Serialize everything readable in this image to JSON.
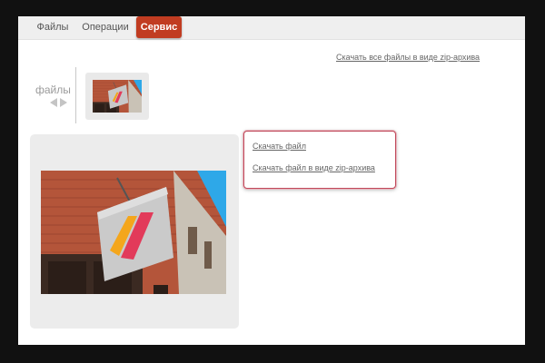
{
  "tabs": [
    {
      "label": "Файлы"
    },
    {
      "label": "Операции"
    },
    {
      "label": "Сервис",
      "active": true
    }
  ],
  "links": {
    "download_all_zip": "Скачать все файлы в виде zip-архива"
  },
  "files_panel": {
    "label": "файлы"
  },
  "download_popup": {
    "download_file": "Скачать файл",
    "download_zip": "Скачать файл в виде zip-архива"
  },
  "icons": [
    "chevron-left-icon",
    "chevron-right-icon"
  ],
  "colors": {
    "active_tab": "#c13c21",
    "tab_bar": "#efefef",
    "popup_border": "#c0495a",
    "panel_bg": "#ececec",
    "sky": "#2ea8e8",
    "brick": "#b4553a"
  }
}
